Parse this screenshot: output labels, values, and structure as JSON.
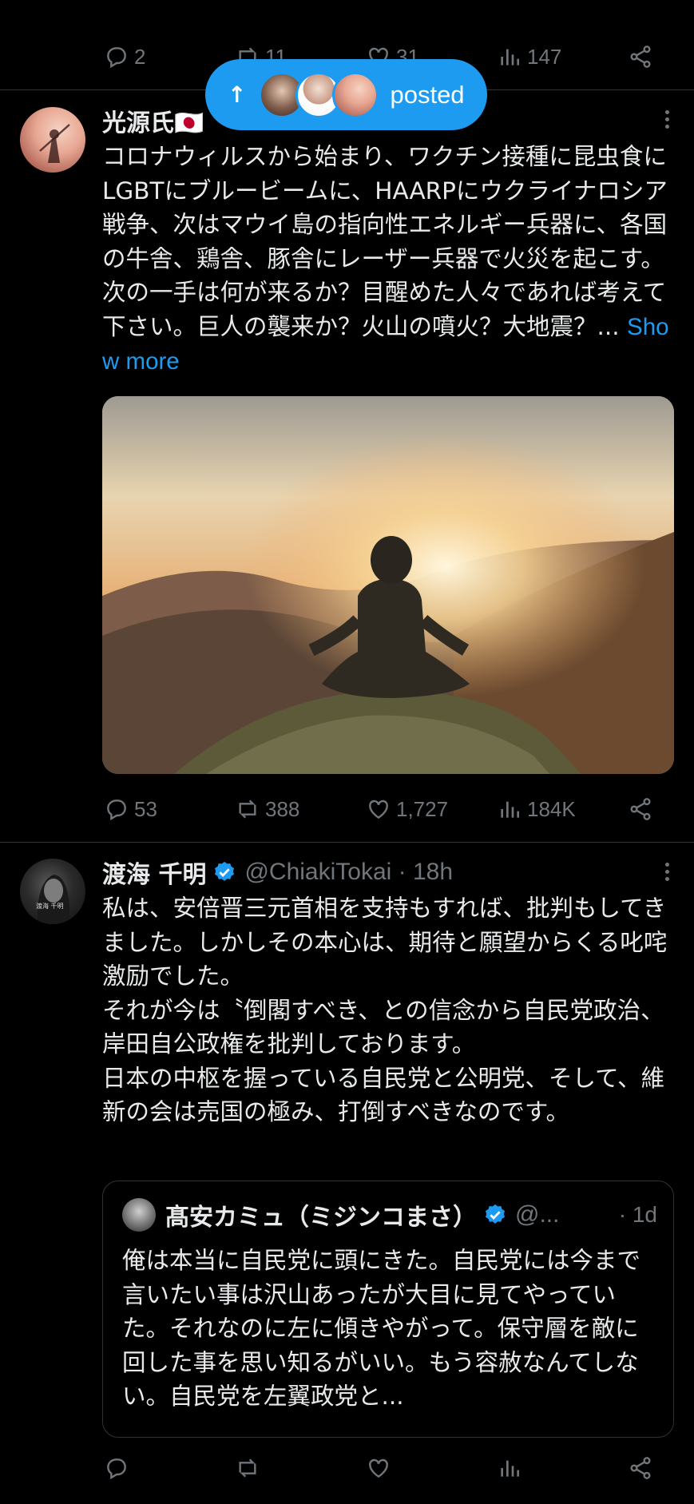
{
  "top_actions": {
    "replies": "2",
    "reposts": "11",
    "likes": "31",
    "views": "147"
  },
  "posted_pill": {
    "label": "posted"
  },
  "post1": {
    "author_name": "光源氏🇯🇵",
    "text": "コロナウィルスから始まり、ワクチン接種に昆虫食にLGBTにブルービームに、HAARPにウクライナロシア戦争、次はマウイ島の指向性エネルギー兵器に、各国の牛舎、鶏舎、豚舎にレーザー兵器で火災を起こす。次の一手は何が来るか？目醒めた人々であれば考えて下さい。巨人の襲来か？火山の噴火？大地震？... ",
    "show_more": "Show more",
    "actions": {
      "replies": "53",
      "reposts": "388",
      "likes": "1,727",
      "views": "184K"
    }
  },
  "post2": {
    "author_name": "渡海 千明",
    "handle": "@ChiakiTokai · 18h",
    "avatar_caption": "渡海 千明",
    "text": "私は、安倍晋三元首相を支持もすれば、批判もしてきました。しかしその本心は、期待と願望からくる叱咤激励でした。\nそれが今は〝倒閣すべき、との信念から自民党政治、岸田自公政権を批判しております。\n日本の中枢を握っている自民党と公明党、そして、維新の会は売国の極み、打倒すべきなのです。",
    "quote": {
      "author_name": "髙安カミュ（ミジンコまさ）",
      "handle": "@...",
      "time": "· 1d",
      "text": "俺は本当に自民党に頭にきた。自民党には今まで言いたい事は沢山あったが大目に見てやっていた。それなのに左に傾きやがって。保守層を敵に回した事を思い知るがいい。もう容赦なんてしない。自民党を左翼政党と..."
    }
  },
  "colors": {
    "accent": "#1d9bf0",
    "muted": "#71767b",
    "background": "#000000",
    "divider": "#2f3336"
  }
}
